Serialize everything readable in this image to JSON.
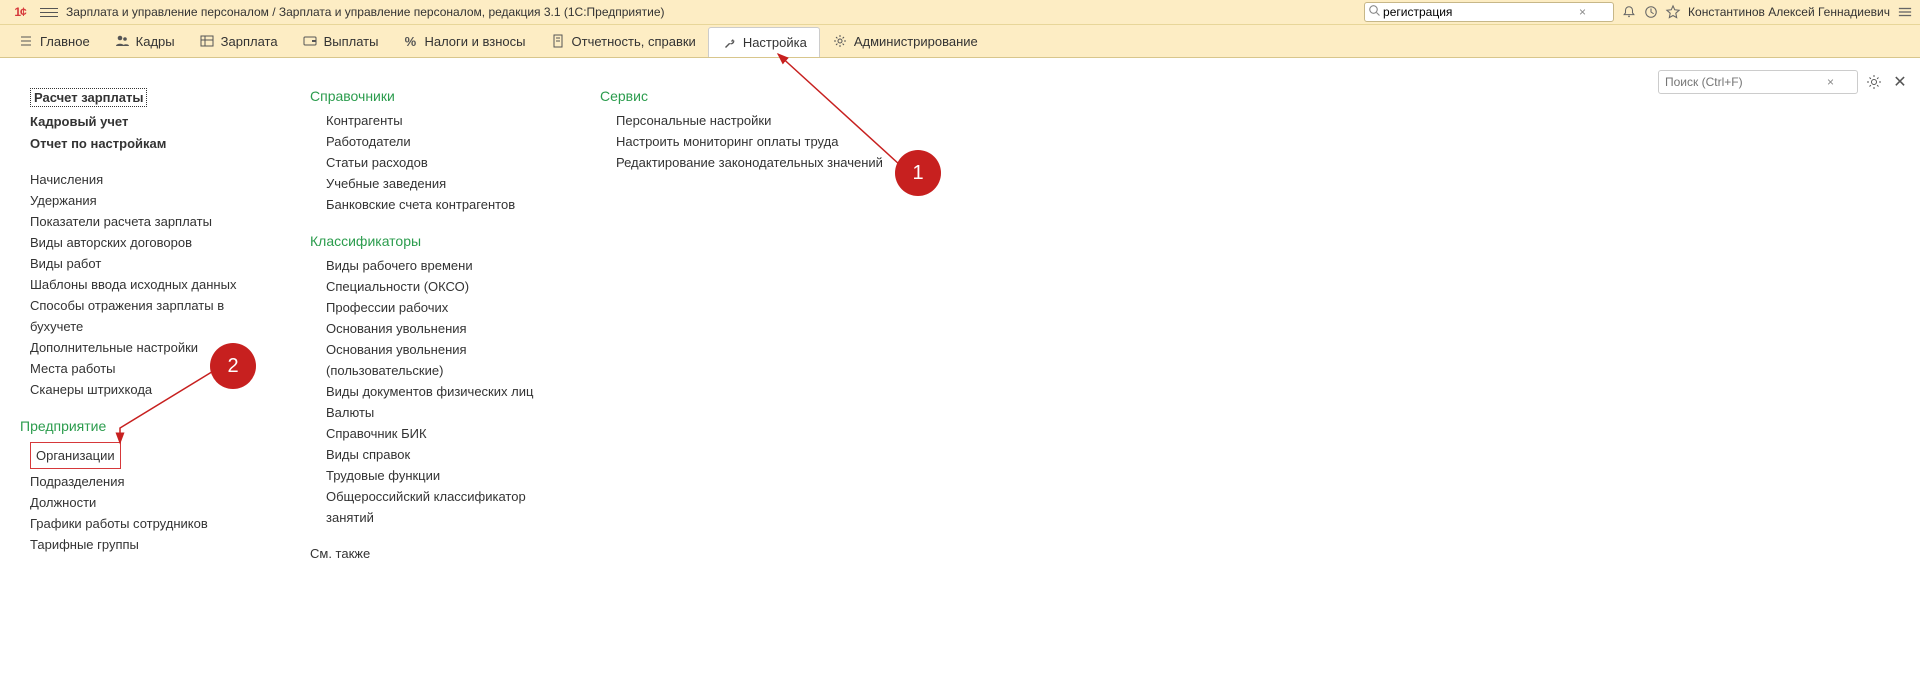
{
  "top": {
    "title": "Зарплата и управление персоналом / Зарплата и управление персоналом, редакция 3.1  (1С:Предприятие)",
    "search_value": "регистрация",
    "username": "Константинов Алексей Геннадиевич"
  },
  "nav": {
    "main": "Главное",
    "kadry": "Кадры",
    "zarplata": "Зарплата",
    "vyplaty": "Выплаты",
    "nalogi": "Налоги и взносы",
    "otchet": "Отчетность, справки",
    "nastroika": "Настройка",
    "admin": "Администрирование"
  },
  "local_search_placeholder": "Поиск (Ctrl+F)",
  "col1": {
    "payroll": "Расчет зарплаты",
    "kadr": "Кадровый учет",
    "report": "Отчет по настройкам",
    "items": [
      "Начисления",
      "Удержания",
      "Показатели расчета зарплаты",
      "Виды авторских договоров",
      "Виды работ",
      "Шаблоны ввода исходных данных",
      "Способы отражения зарплаты в бухучете",
      "Дополнительные настройки",
      "Места работы",
      "Сканеры штрихкода"
    ],
    "pred_head": "Предприятие",
    "pred_items": [
      "Организации",
      "Подразделения",
      "Должности",
      "Графики работы сотрудников",
      "Тарифные группы"
    ]
  },
  "col2": {
    "sprav_head": "Справочники",
    "sprav_items": [
      "Контрагенты",
      "Работодатели",
      "Статьи расходов",
      "Учебные заведения",
      "Банковские счета контрагентов"
    ],
    "klass_head": "Классификаторы",
    "klass_items": [
      "Виды рабочего времени",
      "Специальности (ОКСО)",
      "Профессии рабочих",
      "Основания увольнения",
      "Основания увольнения (пользовательские)",
      "Виды документов физических лиц",
      "Валюты",
      "Справочник БИК",
      "Виды справок",
      "Трудовые функции",
      "Общероссийский классификатор занятий"
    ],
    "see_also": "См. также"
  },
  "col3": {
    "service_head": "Сервис",
    "service_items": [
      "Персональные настройки",
      "Настроить мониторинг оплаты труда",
      "Редактирование законодательных значений"
    ]
  },
  "callouts": {
    "one": "1",
    "two": "2"
  }
}
